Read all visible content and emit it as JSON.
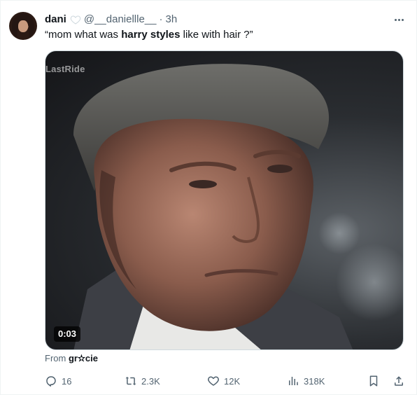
{
  "tweet": {
    "author_name": "dani",
    "handle": "@__daniellle__",
    "separator": "·",
    "time": "3h",
    "text_before": "“mom what was ",
    "text_bold": "harry styles",
    "text_after": " like with hair ?”"
  },
  "media": {
    "watermark": "LastRide",
    "duration": "0:03"
  },
  "source": {
    "prefix": "From ",
    "name": "gr✫cie"
  },
  "actions": {
    "replies": "16",
    "reposts": "2.3K",
    "likes": "12K",
    "views": "318K"
  },
  "icons": {
    "badge": "white-heart-icon",
    "more": "more-icon",
    "reply": "reply-icon",
    "repost": "repost-icon",
    "like": "like-icon",
    "views": "views-icon",
    "bookmark": "bookmark-icon",
    "share": "share-icon"
  },
  "colors": {
    "primary_text": "#0f1419",
    "secondary_text": "#536471",
    "border": "#cfd9de"
  }
}
